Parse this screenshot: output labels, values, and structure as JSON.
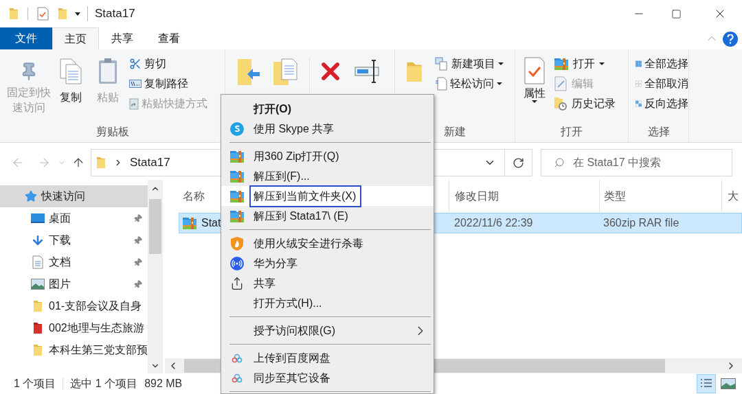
{
  "title_bar": {
    "title": "Stata17"
  },
  "ribbon": {
    "file_tab": "文件",
    "tabs": [
      {
        "label": "主页",
        "selected": true
      },
      {
        "label": "共享",
        "selected": false
      },
      {
        "label": "查看",
        "selected": false
      }
    ],
    "clipboard": {
      "label": "剪贴板",
      "large": [
        {
          "label": "固定到快速访问",
          "disabled": true
        },
        {
          "label": "复制",
          "disabled": false
        },
        {
          "label": "粘贴",
          "disabled": true
        }
      ],
      "small": [
        {
          "label": "剪切",
          "disabled": false
        },
        {
          "label": "复制路径",
          "disabled": false
        },
        {
          "label": "粘贴快捷方式",
          "disabled": true
        }
      ]
    },
    "new": {
      "label": "新建",
      "small": [
        {
          "label": "新建项目",
          "dropdown": true
        },
        {
          "label": "轻松访问",
          "dropdown": true
        }
      ]
    },
    "open": {
      "label": "打开",
      "properties": "属性",
      "small": [
        {
          "label": "打开",
          "disabled": false,
          "dropdown": true
        },
        {
          "label": "编辑",
          "disabled": true,
          "dropdown": false
        },
        {
          "label": "历史记录",
          "disabled": false,
          "dropdown": false
        }
      ]
    },
    "select": {
      "label": "选择",
      "small": [
        {
          "label": "全部选择"
        },
        {
          "label": "全部取消"
        },
        {
          "label": "反向选择"
        }
      ]
    }
  },
  "address_bar": {
    "path": "Stata17",
    "search_placeholder": "在 Stata17 中搜索"
  },
  "nav_pane": {
    "items": [
      {
        "label": "快速访问",
        "selected": true,
        "children": [
          {
            "label": "桌面",
            "kind": "desktop",
            "pinned": true
          },
          {
            "label": "下载",
            "kind": "download",
            "pinned": true
          },
          {
            "label": "文档",
            "kind": "document",
            "pinned": true
          },
          {
            "label": "图片",
            "kind": "picture",
            "pinned": true
          },
          {
            "label": "01-支部会议及自身",
            "kind": "folder",
            "pinned": false
          },
          {
            "label": "002地理与生态旅游",
            "kind": "bookmark",
            "pinned": false
          },
          {
            "label": "本科生第三党支部预",
            "kind": "folder",
            "pinned": false
          }
        ]
      }
    ]
  },
  "file_list": {
    "columns": [
      "名称",
      "修改日期",
      "类型",
      "大"
    ],
    "rows": [
      {
        "name": "Stat",
        "modified": "2022/11/6 22:39",
        "type": "360zip RAR file",
        "selected": true
      }
    ]
  },
  "status_bar": {
    "item_count": "1 个项目",
    "selection": "选中 1 个项目",
    "size": "892 MB"
  },
  "view_buttons": [
    {
      "kind": "details",
      "selected": true
    },
    {
      "kind": "thumbnails",
      "selected": false
    }
  ],
  "context_menu": {
    "items": [
      {
        "kind": "plain",
        "label": "打开(O)",
        "bold": true,
        "selected": false,
        "submenu": false
      },
      {
        "kind": "skype",
        "label": "使用 Skype 共享",
        "bold": false,
        "selected": false,
        "submenu": false
      },
      {
        "kind": "separator"
      },
      {
        "kind": "archive",
        "label": "用360 Zip打开(Q)",
        "bold": false,
        "selected": false,
        "submenu": false
      },
      {
        "kind": "archive",
        "label": "解压到(F)...",
        "bold": false,
        "selected": false,
        "submenu": false
      },
      {
        "kind": "archive",
        "label": "解压到当前文件夹(X)",
        "bold": false,
        "selected": true,
        "submenu": false
      },
      {
        "kind": "archive",
        "label": "解压到 Stata17\\ (E)",
        "bold": false,
        "selected": false,
        "submenu": false
      },
      {
        "kind": "separator"
      },
      {
        "kind": "shield",
        "label": "使用火绒安全进行杀毒",
        "bold": false,
        "selected": false,
        "submenu": false
      },
      {
        "kind": "wireless",
        "label": "华为分享",
        "bold": false,
        "selected": false,
        "submenu": false
      },
      {
        "kind": "share",
        "label": "共享",
        "bold": false,
        "selected": false,
        "submenu": false
      },
      {
        "kind": "plain",
        "label": "打开方式(H)...",
        "bold": false,
        "selected": false,
        "submenu": false
      },
      {
        "kind": "separator"
      },
      {
        "kind": "plain",
        "label": "授予访问权限(G)",
        "bold": false,
        "selected": false,
        "submenu": true
      },
      {
        "kind": "separator"
      },
      {
        "kind": "cloud",
        "label": "上传到百度网盘",
        "bold": false,
        "selected": false,
        "submenu": false
      },
      {
        "kind": "cloud",
        "label": "同步至其它设备",
        "bold": false,
        "selected": false,
        "submenu": false
      },
      {
        "kind": "separator"
      }
    ]
  }
}
